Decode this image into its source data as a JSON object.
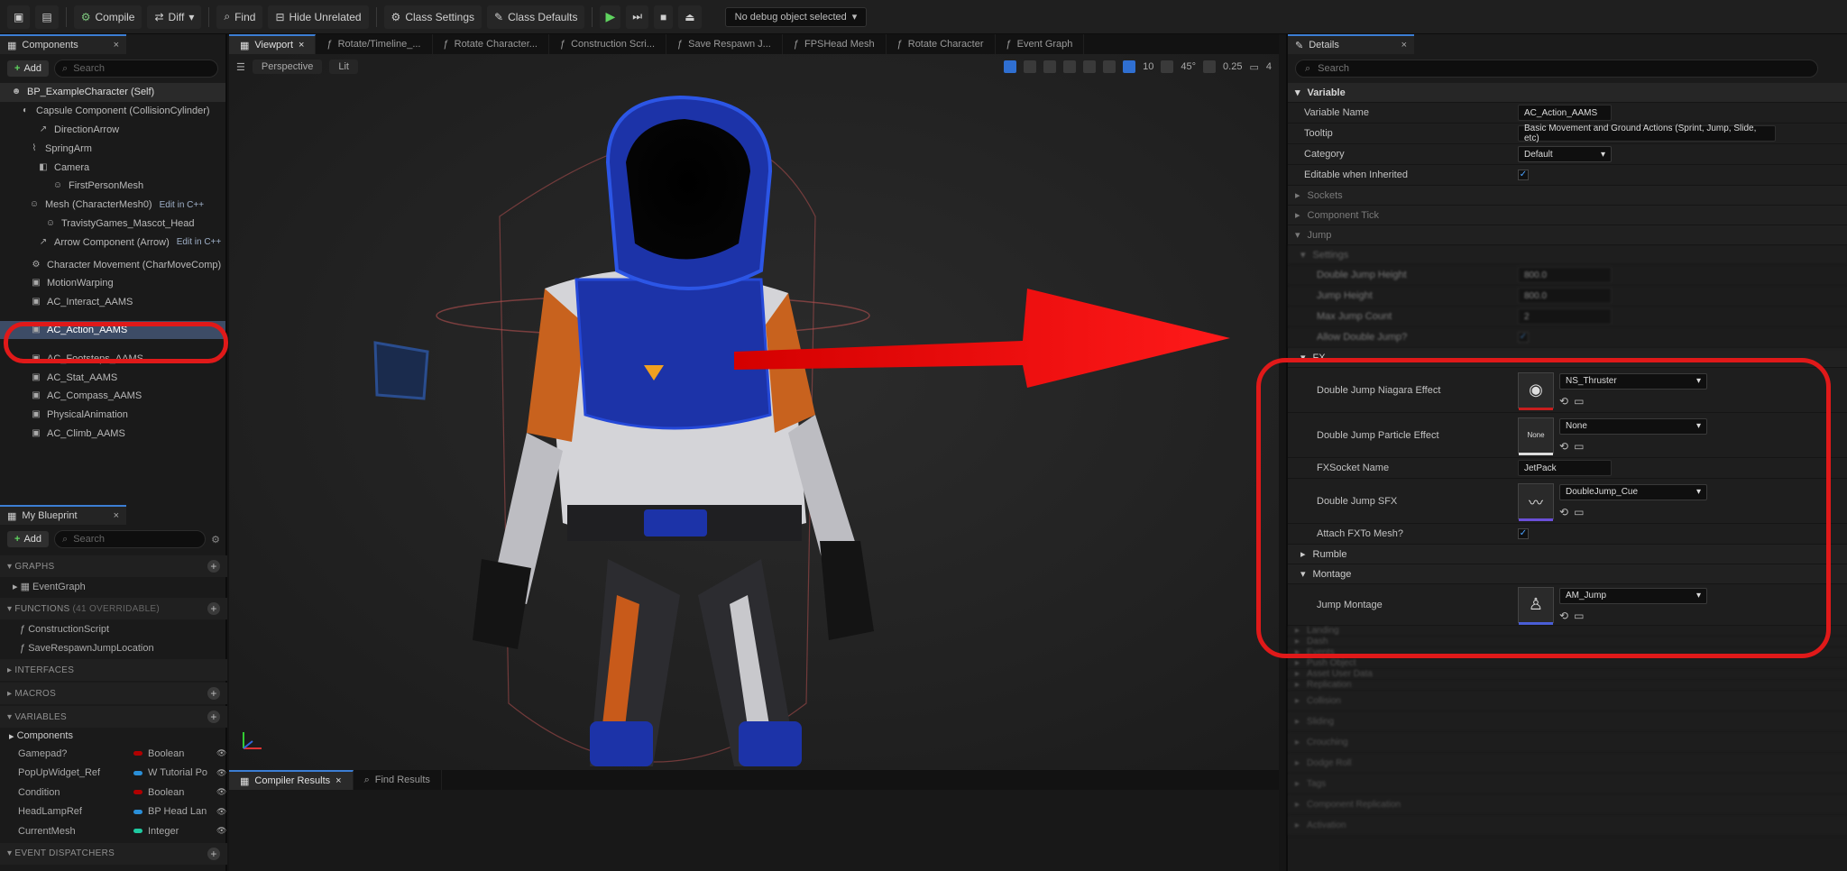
{
  "toolbar": {
    "compile": "Compile",
    "diff": "Diff",
    "find": "Find",
    "hide_unrelated": "Hide Unrelated",
    "class_settings": "Class Settings",
    "class_defaults": "Class Defaults",
    "debug_object": "No debug object selected"
  },
  "components_panel": {
    "tab_label": "Components",
    "add_label": "Add",
    "search_placeholder": "Search",
    "tree": [
      {
        "label": "BP_ExampleCharacter (Self)"
      },
      {
        "label": "Capsule Component (CollisionCylinder)"
      },
      {
        "label": "DirectionArrow"
      },
      {
        "label": "SpringArm"
      },
      {
        "label": "Camera"
      },
      {
        "label": "FirstPersonMesh"
      },
      {
        "label": "Mesh (CharacterMesh0)",
        "link": "Edit in C++"
      },
      {
        "label": "TravistyGames_Mascot_Head"
      },
      {
        "label": "Arrow Component (Arrow)",
        "link": "Edit in C++"
      },
      {
        "label": "Character Movement (CharMoveComp)"
      },
      {
        "label": "MotionWarping"
      },
      {
        "label": "AC_Interact_AAMS"
      },
      {
        "label": "AC_Action_AAMS"
      },
      {
        "label": "AC_Footsteps_AAMS"
      },
      {
        "label": "AC_Stat_AAMS"
      },
      {
        "label": "AC_Compass_AAMS"
      },
      {
        "label": "PhysicalAnimation"
      },
      {
        "label": "AC_Climb_AAMS"
      }
    ]
  },
  "my_blueprint": {
    "tab_label": "My Blueprint",
    "add_label": "Add",
    "search_placeholder": "Search",
    "graphs_label": "GRAPHS",
    "event_graph": "EventGraph",
    "functions_label": "FUNCTIONS",
    "functions_overridable": "(41 OVERRIDABLE)",
    "functions": [
      "ConstructionScript",
      "SaveRespawnJumpLocation"
    ],
    "interfaces_label": "INTERFACES",
    "macros_label": "MACROS",
    "variables_label": "VARIABLES",
    "components_label": "Components",
    "variables": [
      {
        "name": "Gamepad?",
        "type": "Boolean",
        "color": "#b00000"
      },
      {
        "name": "PopUpWidget_Ref",
        "type": "W Tutorial Po",
        "color": "#2a8fd8"
      },
      {
        "name": "Condition",
        "type": "Boolean",
        "color": "#b00000"
      },
      {
        "name": "HeadLampRef",
        "type": "BP Head Lan",
        "color": "#2a8fd8"
      },
      {
        "name": "CurrentMesh",
        "type": "Integer",
        "color": "#1fc9a0"
      }
    ],
    "event_dispatchers_label": "EVENT DISPATCHERS"
  },
  "editor_tabs": [
    "Viewport",
    "Rotate/Timeline_...",
    "Rotate Character...",
    "Construction Scri...",
    "Save Respawn J...",
    "FPSHead Mesh",
    "Rotate Character",
    "Event Graph"
  ],
  "viewport": {
    "perspective": "Perspective",
    "lit": "Lit",
    "grid_snap": "10",
    "rot_snap": "45°",
    "scale_snap": "0.25",
    "camera_speed": "4"
  },
  "bottom_tabs": [
    "Compiler Results",
    "Find Results"
  ],
  "details": {
    "tab_label": "Details",
    "search_placeholder": "Search",
    "variable_section": "Variable",
    "variable_name_label": "Variable Name",
    "variable_name_value": "AC_Action_AAMS",
    "tooltip_label": "Tooltip",
    "tooltip_value": "Basic Movement and Ground Actions (Sprint, Jump, Slide, etc)",
    "category_label": "Category",
    "category_value": "Default",
    "editable_label": "Editable when Inherited",
    "sockets": "Sockets",
    "component_tick": "Component Tick",
    "jump": "Jump",
    "settings": "Settings",
    "double_jump_height_label": "Double Jump Height",
    "double_jump_height_value": "800.0",
    "jump_height_label": "Jump Height",
    "jump_height_value": "800.0",
    "max_jump_count_label": "Max Jump Count",
    "max_jump_count_value": "2",
    "allow_double_jump_label": "Allow Double Jump?",
    "fx": "FX",
    "niagara_label": "Double Jump Niagara Effect",
    "niagara_value": "NS_Thruster",
    "particle_label": "Double Jump Particle Effect",
    "particle_value": "None",
    "particle_thumb": "None",
    "fxsocket_label": "FXSocket Name",
    "fxsocket_value": "JetPack",
    "sfx_label": "Double Jump SFX",
    "sfx_value": "DoubleJump_Cue",
    "attach_label": "Attach FXTo Mesh?",
    "rumble": "Rumble",
    "montage": "Montage",
    "jump_montage_label": "Jump Montage",
    "jump_montage_value": "AM_Jump",
    "collapsed_sections": [
      "Landing",
      "Dash",
      "Events",
      "Push Object",
      "Asset User Data",
      "Replication",
      "Collision",
      "Sliding",
      "Crouching",
      "Dodge Roll",
      "Tags",
      "Component Replication",
      "Activation"
    ]
  },
  "colors": {
    "annotation_red": "#e01919",
    "accent_blue": "#3c7ed4"
  }
}
